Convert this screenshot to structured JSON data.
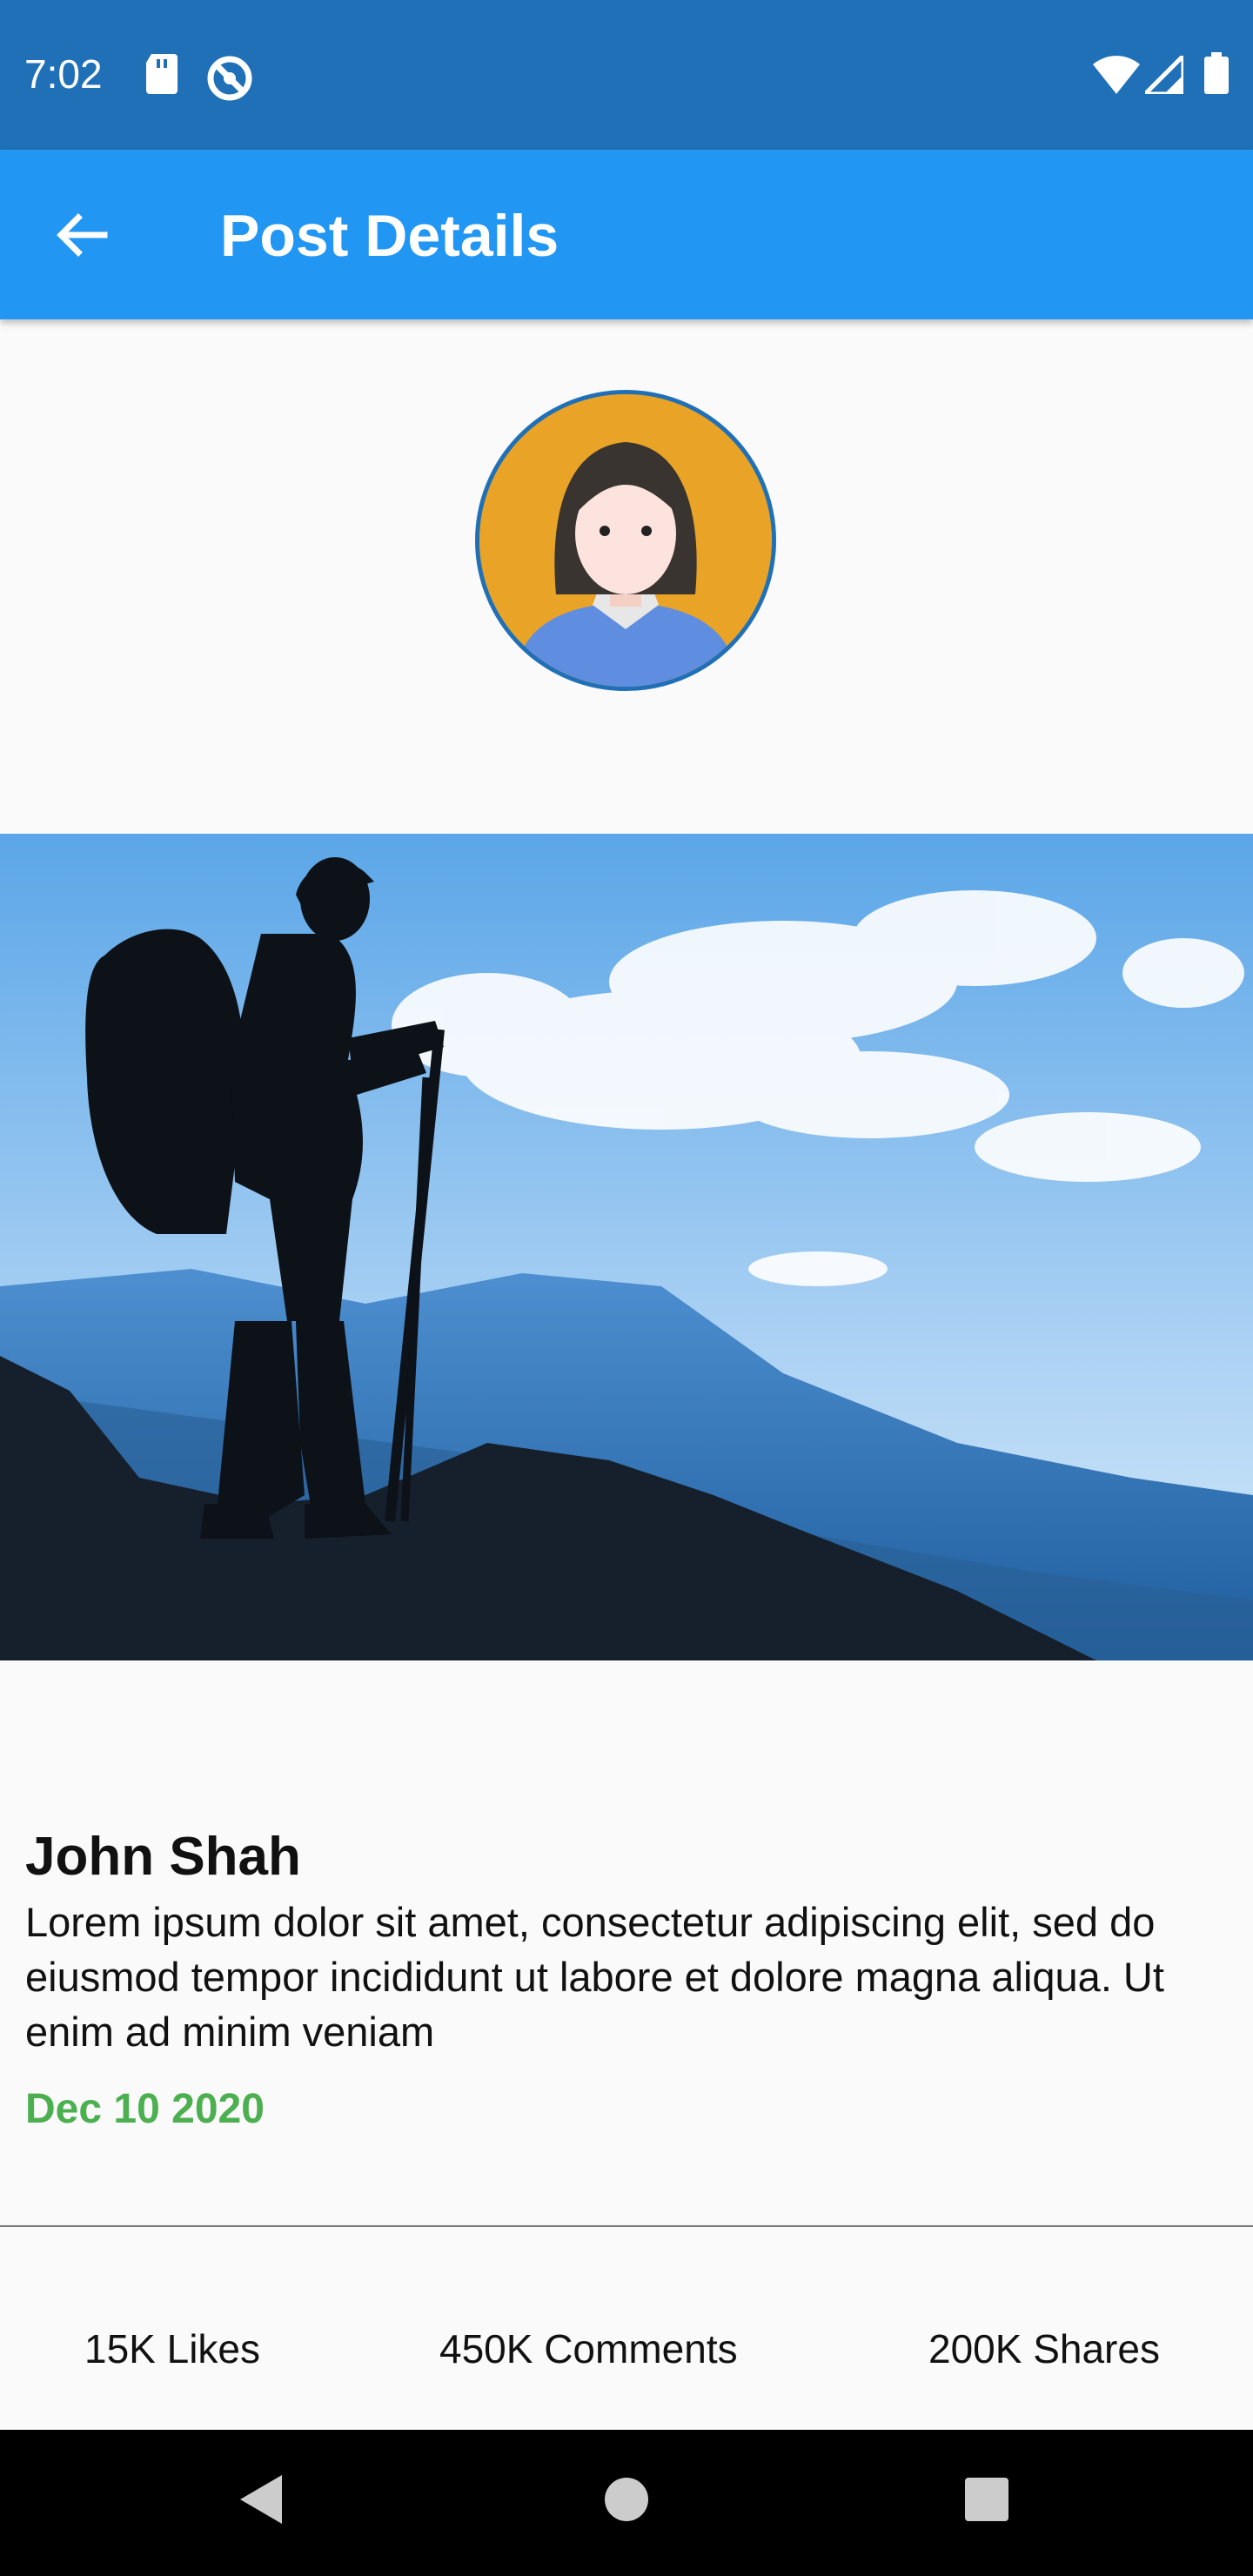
{
  "status_bar": {
    "time": "7:02",
    "left_icons": [
      "sd-card-icon",
      "do-not-disturb-icon"
    ],
    "right_icons": [
      "wifi-icon",
      "signal-icon",
      "battery-icon"
    ]
  },
  "app_bar": {
    "title": "Post Details",
    "back_icon": "arrow-back-icon",
    "color": "#2196f3"
  },
  "post": {
    "author_name": "John Shah",
    "body": "Lorem ipsum dolor sit amet, consectetur adipiscing elit, sed do eiusmod tempor incididunt ut labore et dolore magna aliqua. Ut enim ad minim veniam",
    "date": "Dec 10 2020",
    "date_color": "#4caf50"
  },
  "stats": {
    "likes": "15K Likes",
    "comments": "450K Comments",
    "shares": "200K Shares"
  },
  "nav_bar": {
    "buttons": [
      "back-triangle-icon",
      "home-circle-icon",
      "recents-square-icon"
    ]
  }
}
